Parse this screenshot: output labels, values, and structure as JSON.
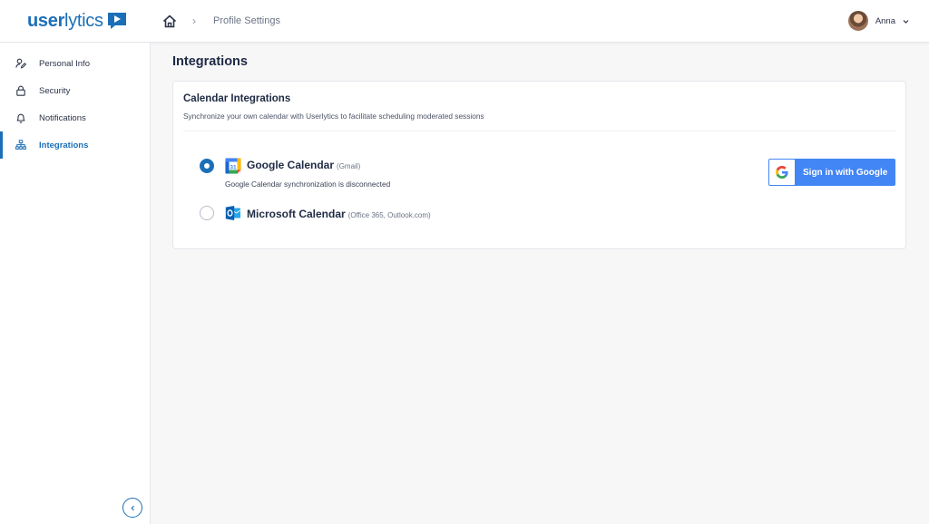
{
  "header": {
    "logo_bold": "user",
    "logo_light": "lytics",
    "breadcrumb_current": "Profile Settings",
    "user_name": "Anna"
  },
  "sidebar": {
    "items": [
      {
        "label": "Personal Info",
        "icon": "user-edit-icon",
        "active": false
      },
      {
        "label": "Security",
        "icon": "lock-icon",
        "active": false
      },
      {
        "label": "Notifications",
        "icon": "bell-icon",
        "active": false
      },
      {
        "label": "Integrations",
        "icon": "sitemap-icon",
        "active": true
      }
    ]
  },
  "main": {
    "title": "Integrations",
    "card": {
      "title": "Calendar Integrations",
      "subtitle": "Synchronize your own calendar with Userlytics to facilitate scheduling moderated sessions",
      "options": [
        {
          "name": "Google Calendar",
          "hint": "(Gmail)",
          "status": "Google Calendar synchronization is disconnected",
          "selected": true,
          "icon": "google-calendar-icon"
        },
        {
          "name": "Microsoft Calendar",
          "hint": "(Office 365, Outlook.com)",
          "selected": false,
          "icon": "outlook-icon"
        }
      ],
      "signin_button": "Sign in with Google"
    }
  },
  "colors": {
    "accent": "#1c6fb7",
    "google_blue": "#4285f4",
    "background": "#f7f7f8"
  }
}
